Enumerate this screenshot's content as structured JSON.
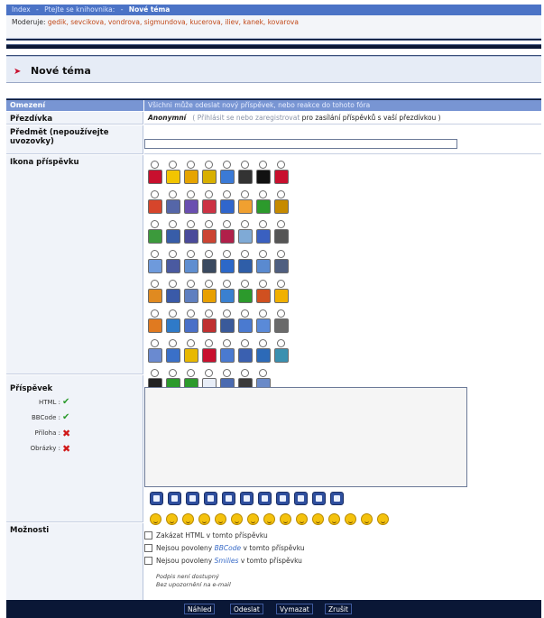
{
  "breadcrumb": {
    "sep": "-",
    "items": [
      "Index",
      "Ptejte se knihovnika:",
      "Nové téma"
    ]
  },
  "moderators": {
    "label": "Moderuje:",
    "names": "gedik, sevcikova, vondrova, sigmundova, kucerova, iliev, kanek, kovarova"
  },
  "page_title": "Nové téma",
  "form": {
    "header_label": "Omezení",
    "header_text": "Všichni může odeslat nový příspěvek, nebo reakce do tohoto fóra",
    "nickname_label": "Přezdívka",
    "nickname_value": "Anonymní",
    "login_link": "( Přihlásit se nebo zaregistrovat",
    "login_suffix": "pro zasílání příspěvků s vaší přezdívkou )",
    "subject_label": "Předmět (nepoužívejte uvozovky)",
    "subject_value": "",
    "icon_label": "Ikona příspěvku",
    "post_label": "Příspěvek",
    "perms": [
      {
        "label": "HTML :",
        "ok": true
      },
      {
        "label": "BBCode :",
        "ok": true
      },
      {
        "label": "Příloha :",
        "ok": false
      },
      {
        "label": "Obrázky :",
        "ok": false
      }
    ],
    "options_label": "Možnosti",
    "options": [
      {
        "label": "Zakázat HTML v tomto příspěvku"
      },
      {
        "label_pre": "Nejsou povoleny",
        "label_em": "BBCode",
        "label_post": "v tomto příspěvku"
      },
      {
        "label_pre": "Nejsou povoleny",
        "label_em": "Smilies",
        "label_post": "v tomto příspěvku"
      }
    ],
    "note1": "Podpis není dostupný",
    "note2": "Bez upozornění na e-mail"
  },
  "icon_colors": [
    [
      "#c8102e",
      "#f2c500",
      "#e6a400",
      "#d8b000",
      "#3b7ad6",
      "#333333",
      "#111111",
      "#c8102e"
    ],
    [
      "#d6452b",
      "#5566a8",
      "#6a4fb0",
      "#cc3344",
      "#3066cc",
      "#f0a030",
      "#2c9a2c",
      "#c68a00"
    ],
    [
      "#3c9a3c",
      "#385da8",
      "#4a4a9a",
      "#cc4433",
      "#b0204a",
      "#7faad6",
      "#3a60c0",
      "#555555"
    ],
    [
      "#6e9adc",
      "#4a5aa0",
      "#5f8ed0",
      "#3a4a60",
      "#2c68c8",
      "#2f5ea8",
      "#5a8ad0",
      "#4f5f80"
    ],
    [
      "#e08a20",
      "#3a5aa8",
      "#5f7fc0",
      "#e8a000",
      "#3a80d0",
      "#2c9a2c",
      "#d05020",
      "#f0b000"
    ],
    [
      "#e07a20",
      "#2f7ac8",
      "#4a70c8",
      "#c03030",
      "#3a5a9a",
      "#4a7ad0",
      "#5a8ad8",
      "#6a6a6a"
    ],
    [
      "#6a8ad0",
      "#3a70c8",
      "#e8b800",
      "#c8102e",
      "#4a7ad0",
      "#3a60b0",
      "#2c6ab8",
      "#3a90b0"
    ],
    [
      "#222222",
      "#2c9a2c",
      "#2c9a2c",
      "#e8eef8",
      "#4a6ab0",
      "#3a3a3a",
      "#6a8ac8"
    ]
  ],
  "buttons": [
    "Náhled",
    "Odeslat",
    "Vymazat",
    "Zrušit"
  ]
}
